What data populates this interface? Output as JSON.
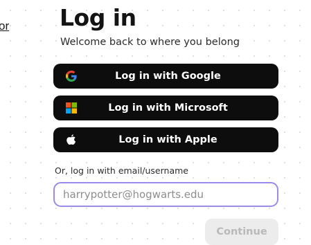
{
  "edge_link": {
    "text": "or"
  },
  "header": {
    "title": "Log in",
    "subtitle": "Welcome back to where you belong"
  },
  "sso": {
    "google": {
      "label": "Log in with Google",
      "icon": "google-icon"
    },
    "microsoft": {
      "label": "Log in with Microsoft",
      "icon": "microsoft-icon"
    },
    "apple": {
      "label": "Log in with Apple",
      "icon": "apple-icon"
    }
  },
  "email_login": {
    "label": "Or, log in with email/username",
    "placeholder": "harrypotter@hogwarts.edu",
    "value": "",
    "continue_label": "Continue"
  },
  "colors": {
    "button_bg": "#0d0d0d",
    "input_border": "#9a8be6",
    "continue_disabled_bg": "#ececec",
    "continue_disabled_text": "#b9b9b9",
    "google_blue": "#4285F4",
    "google_red": "#EA4335",
    "google_yellow": "#FBBC05",
    "google_green": "#34A853",
    "ms_red": "#F25022",
    "ms_green": "#7FBA00",
    "ms_blue": "#00A4EF",
    "ms_yellow": "#FFB900"
  }
}
